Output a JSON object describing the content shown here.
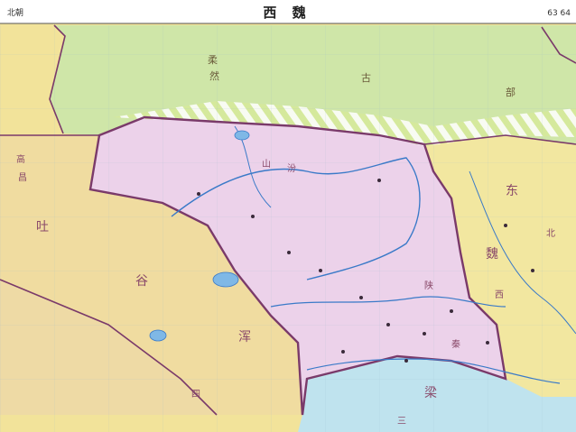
{
  "header": {
    "left_label": "北朝",
    "title": "西 魏",
    "page_numbers": "63 64"
  },
  "colors": {
    "steppe_green": "#cfe6a8",
    "western_yellow": "#f2e39a",
    "tuyuhun_tan": "#f0dca0",
    "xiwei_pink": "#ecd2ea",
    "dongwei_yellow": "#f2e7a0",
    "south_blue": "#bfe3ee",
    "border_purple": "#7a3a6a",
    "hatch_green": "#d6ea9a"
  },
  "regions": {
    "rouran": {
      "chars": [
        "柔",
        "然"
      ]
    },
    "tujue": {
      "chars": [
        "古",
        "部"
      ]
    },
    "tuyuhun": {
      "chars": [
        "吐",
        "谷",
        "浑"
      ]
    },
    "gaochang": {
      "chars": [
        "高",
        "昌"
      ]
    },
    "dongwei": {
      "chars": [
        "东",
        "魏"
      ]
    },
    "liang": {
      "chars": [
        "梁"
      ]
    },
    "misc": {
      "chars": [
        "山",
        "陕",
        "汾",
        "秦",
        "西",
        "四",
        "北",
        "三"
      ]
    }
  }
}
